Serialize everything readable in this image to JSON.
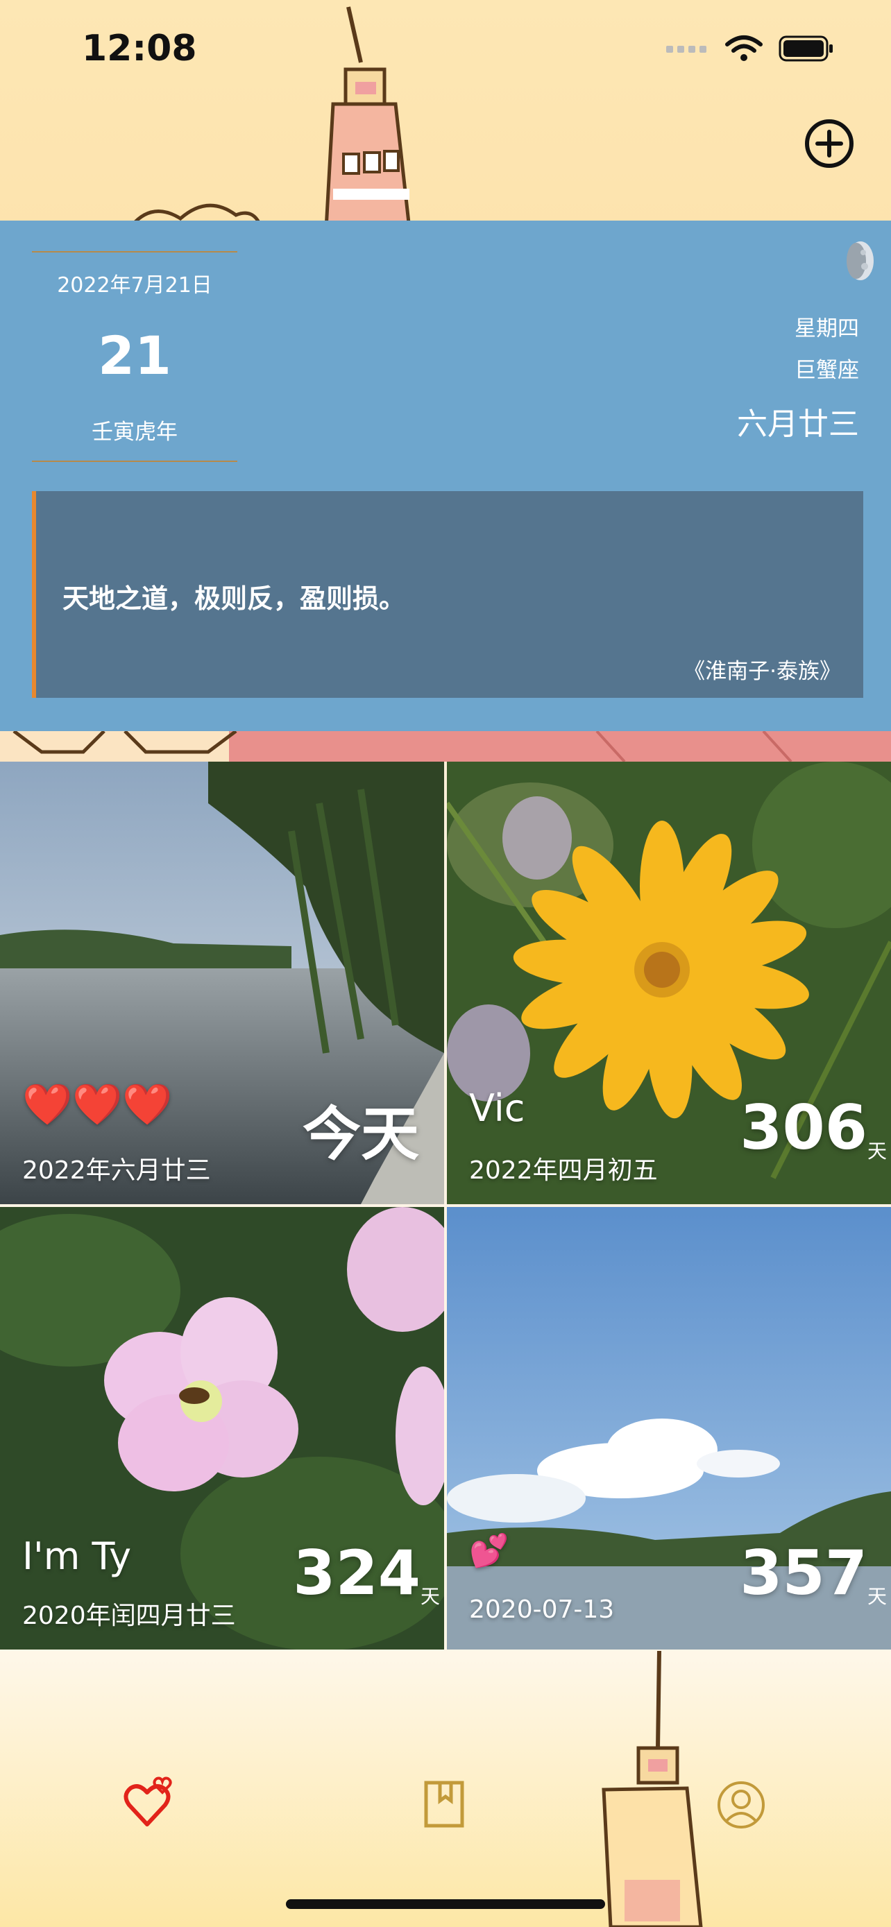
{
  "status_bar": {
    "time": "12:08"
  },
  "calendar": {
    "solar_date": "2022年7月21日",
    "day": "21",
    "ganzhi_year": "壬寅虎年",
    "weekday": "星期四",
    "zodiac": "巨蟹座",
    "lunar_date": "六月廿三",
    "quote": "天地之道，极则反，盈则损。",
    "quote_source": "《淮南子·泰族》"
  },
  "tiles": [
    {
      "title": "",
      "hearts": "❤️❤️❤️",
      "date": "2022年六月廿三",
      "count": "今天",
      "unit": ""
    },
    {
      "title": "Vic",
      "date": "2022年四月初五",
      "count": "306",
      "unit": "天"
    },
    {
      "title": "I'm Ty",
      "date": "2020年闰四月廿三",
      "count": "324",
      "unit": "天"
    },
    {
      "title": "",
      "hearts": "💕",
      "date": "2020-07-13",
      "count": "357",
      "unit": "天"
    }
  ],
  "tab_bar": {
    "items": [
      {
        "name": "love",
        "icon": "hearts-icon",
        "active": true
      },
      {
        "name": "journal",
        "icon": "bookmark-icon",
        "active": false
      },
      {
        "name": "profile",
        "icon": "user-icon",
        "active": false
      }
    ]
  },
  "colors": {
    "panel": "#6ea6cd",
    "quote_bg": "#55758f",
    "quote_accent": "#e8882d",
    "active_tab": "#e2231a",
    "inactive_tab": "#c29a3a"
  }
}
